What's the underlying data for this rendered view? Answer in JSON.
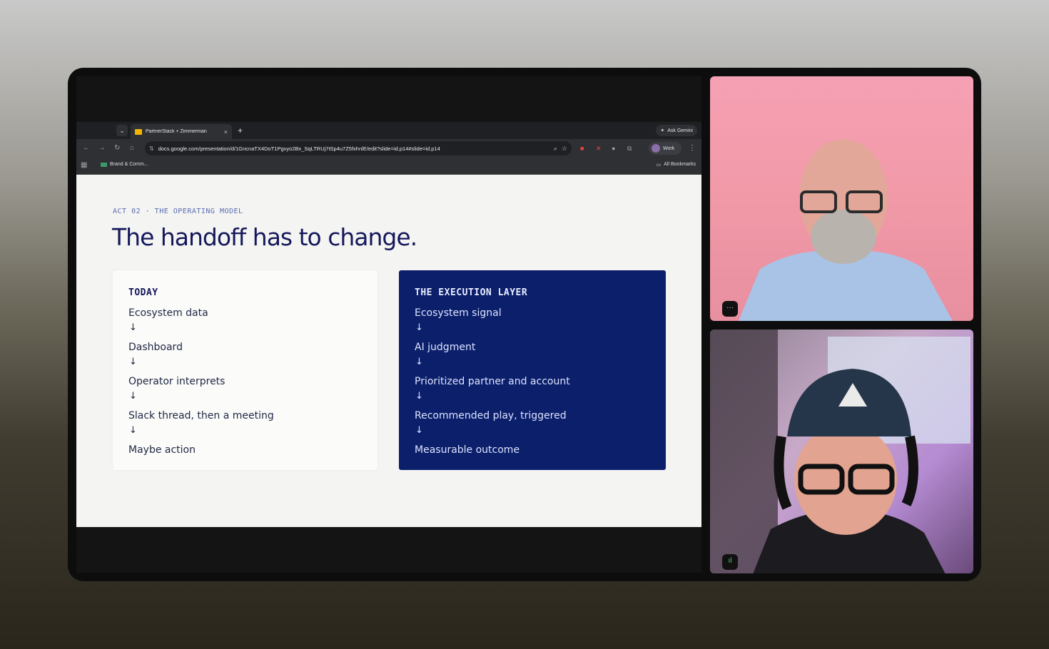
{
  "browser": {
    "tab_title": "PartnerStack + Zimmerman",
    "tab_close": "×",
    "new_tab": "+",
    "ask_gemini": "Ask Gemini",
    "url": "docs.google.com/presentation/d/1GncnaTX4DoT1Pgvyo2Bx_SqLTRUj7tSp4u7Z5fxhnlE/edit?slide=id.p14#slide=id.p14",
    "profile_label": "Work",
    "bookmark_item": "Brand & Comm...",
    "all_bookmarks": "All Bookmarks"
  },
  "slide": {
    "eyebrow": "ACT 02 · THE OPERATING MODEL",
    "title": "The handoff has to change.",
    "today": {
      "title": "TODAY",
      "steps": [
        "Ecosystem data",
        "Dashboard",
        "Operator interprets",
        "Slack thread, then a meeting",
        "Maybe action"
      ]
    },
    "execution": {
      "title": "THE EXECUTION LAYER",
      "steps": [
        "Ecosystem signal",
        "AI judgment",
        "Prioritized partner and account",
        "Recommended play, triggered",
        "Measurable outcome"
      ]
    },
    "arrow": "↓"
  },
  "participants": {
    "tile1_badge": "···",
    "tile2_badge": "ıl"
  },
  "icons": {
    "back": "back-arrow-icon",
    "forward": "forward-arrow-icon",
    "reload": "reload-icon",
    "home": "home-icon",
    "zoom": "zoom-icon",
    "star": "star-icon"
  },
  "colors": {
    "slide_title": "#15185a",
    "execution_card": "#0b1f6b",
    "eyebrow": "#5a6db0"
  }
}
